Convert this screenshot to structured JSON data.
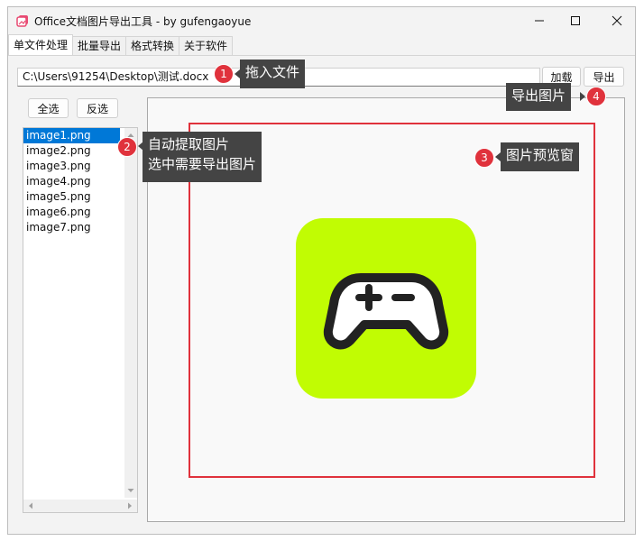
{
  "window": {
    "title": "Office文档图片导出工具 - by gufengaoyue",
    "icon": "app-image-icon",
    "controls": [
      "minimize-icon",
      "maximize-icon",
      "close-icon"
    ]
  },
  "tabs": [
    {
      "label": "单文件处理",
      "active": true
    },
    {
      "label": "批量导出",
      "active": false
    },
    {
      "label": "格式转换",
      "active": false
    },
    {
      "label": "关于软件",
      "active": false
    }
  ],
  "file": {
    "path": "C:\\Users\\91254\\Desktop\\测试.docx",
    "load_label": "加载",
    "export_label": "导出"
  },
  "list": {
    "select_all_label": "全选",
    "invert_label": "反选",
    "items": [
      "image1.png",
      "image2.png",
      "image3.png",
      "image4.png",
      "image5.png",
      "image6.png",
      "image7.png"
    ],
    "selected_index": 0
  },
  "preview": {
    "image_icon": "gamepad-icon",
    "image_bg_color": "#c1fc03"
  },
  "callouts": [
    {
      "number": "1",
      "text": "拖入文件"
    },
    {
      "number": "2",
      "text_line1": "自动提取图片",
      "text_line2": "选中需要导出图片"
    },
    {
      "number": "3",
      "text": "图片预览窗"
    },
    {
      "number": "4",
      "text": "导出图片"
    }
  ],
  "colors": {
    "selection": "#0078d7",
    "annotation_red": "#e0323c",
    "callout_bg": "#444444"
  }
}
